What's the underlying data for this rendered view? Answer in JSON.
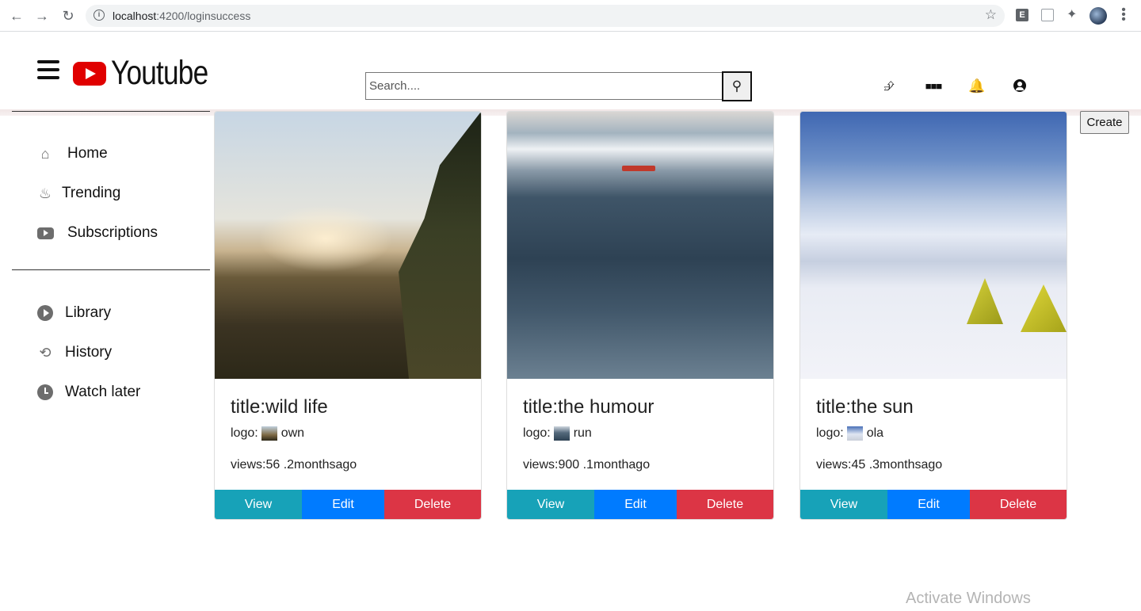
{
  "browser": {
    "url_host": "localhost",
    "url_path": ":4200/loginsuccess",
    "extension_e_label": "E"
  },
  "stray_text": "lo",
  "header": {
    "brand": "Youtube",
    "search_placeholder": "Search....",
    "create_label": "Create"
  },
  "sidebar": {
    "items_top": [
      {
        "label": "Home",
        "icon": "home-icon"
      },
      {
        "label": "Trending",
        "icon": "flame-icon"
      },
      {
        "label": "Subscriptions",
        "icon": "subscriptions-icon"
      }
    ],
    "items_bottom": [
      {
        "label": "Library",
        "icon": "play-circle-icon"
      },
      {
        "label": "History",
        "icon": "history-icon"
      },
      {
        "label": "Watch later",
        "icon": "clock-icon"
      }
    ]
  },
  "cards": [
    {
      "title": "title:wild life",
      "logo_label": "logo:",
      "owner": "own",
      "views": "views:56 .2monthsago",
      "view": "View",
      "edit": "Edit",
      "delete": "Delete"
    },
    {
      "title": "title:the humour",
      "logo_label": "logo:",
      "owner": "run",
      "views": "views:900 .1monthago",
      "view": "View",
      "edit": "Edit",
      "delete": "Delete"
    },
    {
      "title": "title:the sun",
      "logo_label": "logo:",
      "owner": "ola",
      "views": "views:45 .3monthsago",
      "view": "View",
      "edit": "Edit",
      "delete": "Delete"
    }
  ],
  "colors": {
    "view": "#17a2b8",
    "edit": "#007bff",
    "delete": "#dc3545",
    "brand_red": "#e00000"
  },
  "watermark": "Activate Windows"
}
